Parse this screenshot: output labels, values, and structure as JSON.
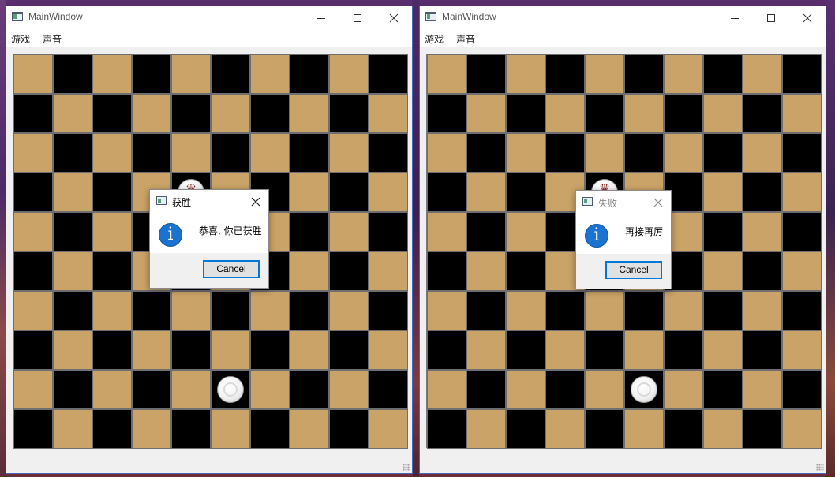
{
  "windows": [
    {
      "title": "MainWindow",
      "menu": [
        "游戏",
        "声音"
      ],
      "dialog": {
        "title": "获胜",
        "message": "恭喜, 你已获胜",
        "button": "Cancel",
        "title_color": "#000000"
      }
    },
    {
      "title": "MainWindow",
      "menu": [
        "游戏",
        "声音"
      ],
      "dialog": {
        "title": "失败",
        "message": "再接再厉",
        "button": "Cancel",
        "title_color": "#8a8a8a"
      }
    }
  ],
  "board": {
    "rows": 10,
    "cols": 10,
    "light_color": "#c9a367",
    "dark_color": "#000000",
    "pieces": [
      {
        "row": 3,
        "col": 4,
        "type": "king",
        "icon": "crown-icon"
      },
      {
        "row": 8,
        "col": 5,
        "type": "man"
      }
    ]
  },
  "icons": {
    "app": "app-window-icon",
    "minimize": "minimize-icon",
    "maximize": "maximize-icon",
    "close": "close-icon",
    "info": "info-icon",
    "crown": "crown-icon"
  }
}
